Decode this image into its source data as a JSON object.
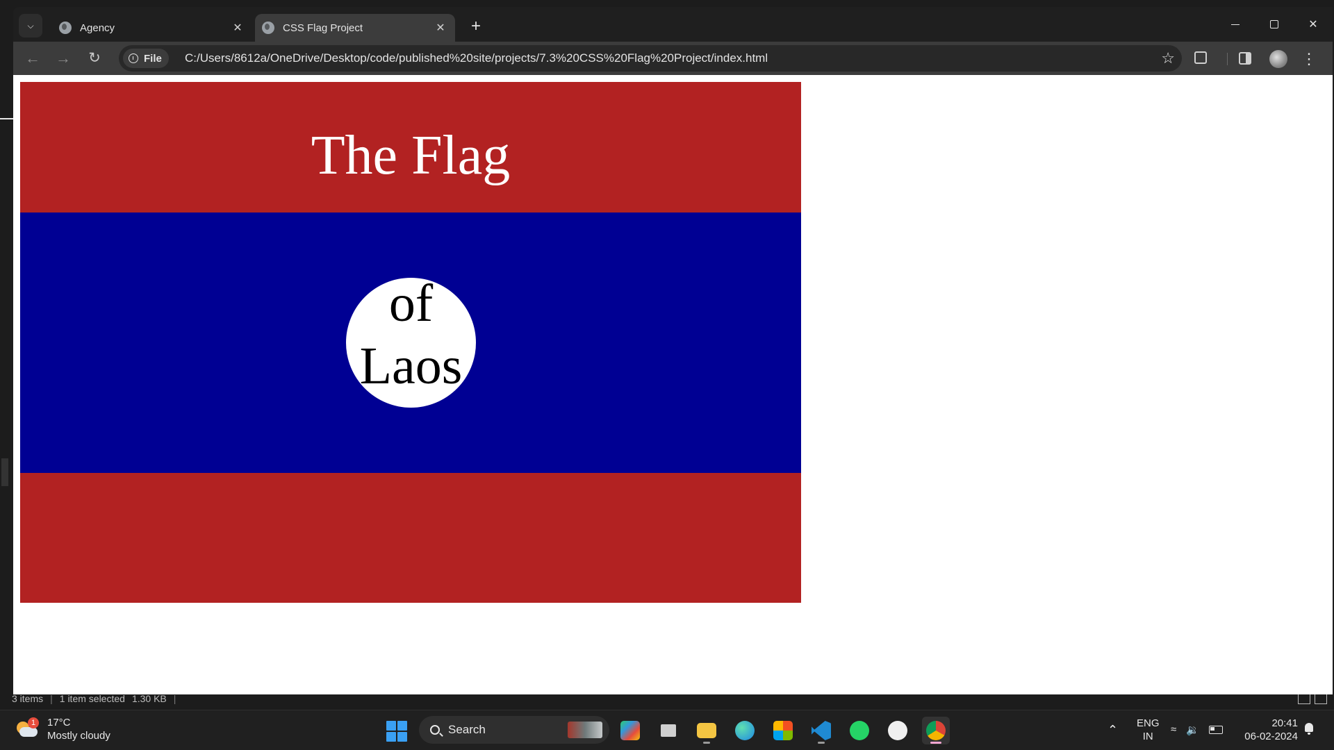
{
  "explorer": {
    "status_items": "3 items",
    "status_selected": "1 item selected",
    "status_size": "1.30 KB"
  },
  "browser": {
    "tabs": [
      {
        "title": "Agency",
        "icon": "globe-icon"
      },
      {
        "title": "CSS Flag Project",
        "icon": "globe-icon",
        "active": true
      }
    ],
    "site_chip": "File",
    "url": "C:/Users/8612a/OneDrive/Desktop/code/published%20site/projects/7.3%20CSS%20Flag%20Project/index.html"
  },
  "page": {
    "title_line": "The Flag",
    "circle_line1": "of",
    "circle_line2": "Laos",
    "colors": {
      "red": "#b22222",
      "blue": "#000093",
      "white": "#ffffff"
    }
  },
  "taskbar": {
    "weather_temp": "17°C",
    "weather_desc": "Mostly cloudy",
    "weather_badge": "1",
    "search_label": "Search",
    "lang_line1": "ENG",
    "lang_line2": "IN",
    "time": "20:41",
    "date": "06-02-2024",
    "apps": [
      "copilot-icon",
      "task-view-icon",
      "file-explorer-icon",
      "edge-icon",
      "store-icon",
      "vscode-icon",
      "whatsapp-icon",
      "github-icon",
      "chrome-icon"
    ]
  }
}
